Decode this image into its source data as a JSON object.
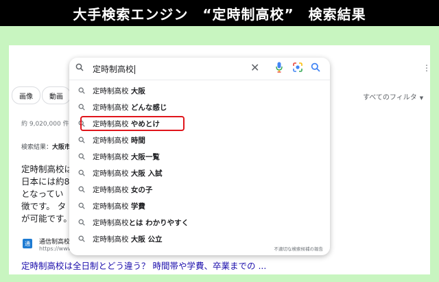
{
  "banner": {
    "title": "大手検索エンジン　“定時制高校”　検索結果"
  },
  "search": {
    "query": "定時制高校"
  },
  "chips": {
    "images": "画像",
    "video": "動画"
  },
  "filters": {
    "all": "すべてのフィルタ"
  },
  "results": {
    "count": "約 9,020,000 件",
    "search_label_prefix": "検索結果：",
    "search_label_bold": "大阪市",
    "snippet_lines": [
      "定時制高校は",
      "日本には約8",
      "となってい",
      "徴です。 タ",
      "が可能です。"
    ],
    "site_icon_text": "通",
    "site_name": "通信制高校",
    "site_url": "https://www.",
    "link_title": "定時制高校は全日制とどう違う？ 時間帯や学費、卒業までの ..."
  },
  "suggestions": [
    {
      "prefix": "定時制高校 ",
      "bold": "大阪"
    },
    {
      "prefix": "定時制高校 ",
      "bold": "どんな感じ"
    },
    {
      "prefix": "定時制高校 ",
      "bold": "やめとけ"
    },
    {
      "prefix": "定時制高校 ",
      "bold": "時間"
    },
    {
      "prefix": "定時制高校 ",
      "bold": "大阪一覧"
    },
    {
      "prefix": "定時制高校 ",
      "bold": "大阪 入試"
    },
    {
      "prefix": "定時制高校 ",
      "bold": "女の子"
    },
    {
      "prefix": "定時制高校 ",
      "bold": "学費"
    },
    {
      "prefix": "定時制高校",
      "bold": "とは わかりやすく"
    },
    {
      "prefix": "定時制高校 ",
      "bold": "大阪 公立"
    }
  ],
  "report_link": "不適切な検索候補の報告",
  "highlight_index": 2,
  "colors": {
    "highlight": "#e0141a",
    "link": "#1a0dab",
    "background": "#c8f5c0"
  },
  "icons": {
    "search": "search-icon",
    "clear": "close-icon",
    "voice": "mic-icon",
    "lens": "lens-icon"
  }
}
